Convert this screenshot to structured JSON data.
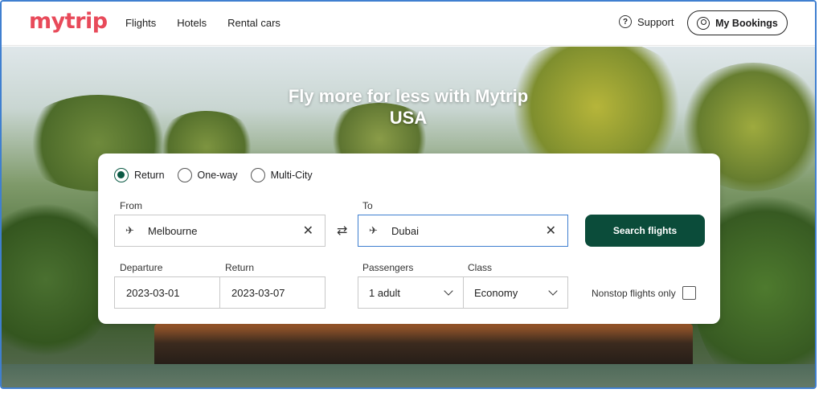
{
  "header": {
    "logo": "mytrip",
    "nav": [
      "Flights",
      "Hotels",
      "Rental cars"
    ],
    "support": "Support",
    "bookings": "My Bookings"
  },
  "hero": {
    "title_line1": "Fly more for less with Mytrip",
    "title_line2": "USA"
  },
  "search": {
    "trip_types": [
      {
        "label": "Return",
        "selected": true
      },
      {
        "label": "One-way",
        "selected": false
      },
      {
        "label": "Multi-City",
        "selected": false
      }
    ],
    "from_label": "From",
    "from_value": "Melbourne",
    "to_label": "To",
    "to_value": "Dubai",
    "button": "Search flights",
    "departure_label": "Departure",
    "departure_value": "2023-03-01",
    "return_label": "Return",
    "return_value": "2023-03-07",
    "passengers_label": "Passengers",
    "passengers_value": "1 adult",
    "class_label": "Class",
    "class_value": "Economy",
    "nonstop_label": "Nonstop flights only",
    "nonstop_checked": false
  },
  "colors": {
    "brand": "#e84a5a",
    "primary": "#0b4c3a",
    "focus": "#3f7fd0"
  },
  "icons": {
    "from": "plane-takeoff-icon",
    "to": "plane-landing-icon",
    "swap": "swap-icon",
    "clear": "close-icon",
    "support": "help-icon",
    "bookings": "user-icon",
    "dropdown": "chevron-down-icon"
  }
}
